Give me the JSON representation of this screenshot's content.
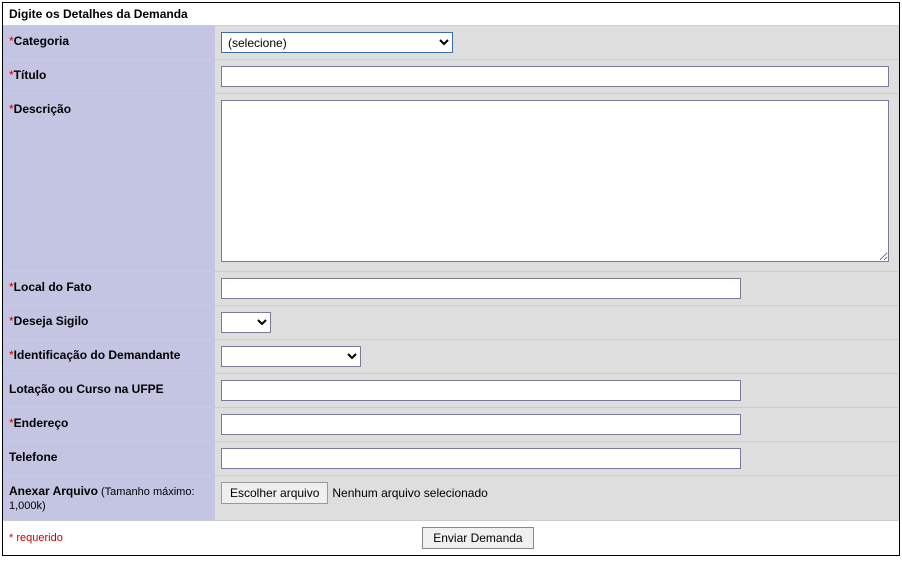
{
  "header": "Digite os Detalhes da Demanda",
  "labels": {
    "categoria": "Categoria",
    "titulo": "Título",
    "descricao": "Descrição",
    "local": "Local do Fato",
    "sigilo": "Deseja Sigilo",
    "identificacao": "Identificação do Demandante",
    "lotacao": "Lotação ou Curso na UFPE",
    "endereco": "Endereço",
    "telefone": "Telefone",
    "anexar": "Anexar Arquivo",
    "anexar_sub": " (Tamanho máximo: 1,000k)"
  },
  "fields": {
    "categoria_placeholder": "(selecione)",
    "file_button": "Escolher arquivo",
    "file_status": "Nenhum arquivo selecionado"
  },
  "footer": {
    "required": "* requerido",
    "submit": "Enviar Demanda"
  },
  "asterisk": "*"
}
